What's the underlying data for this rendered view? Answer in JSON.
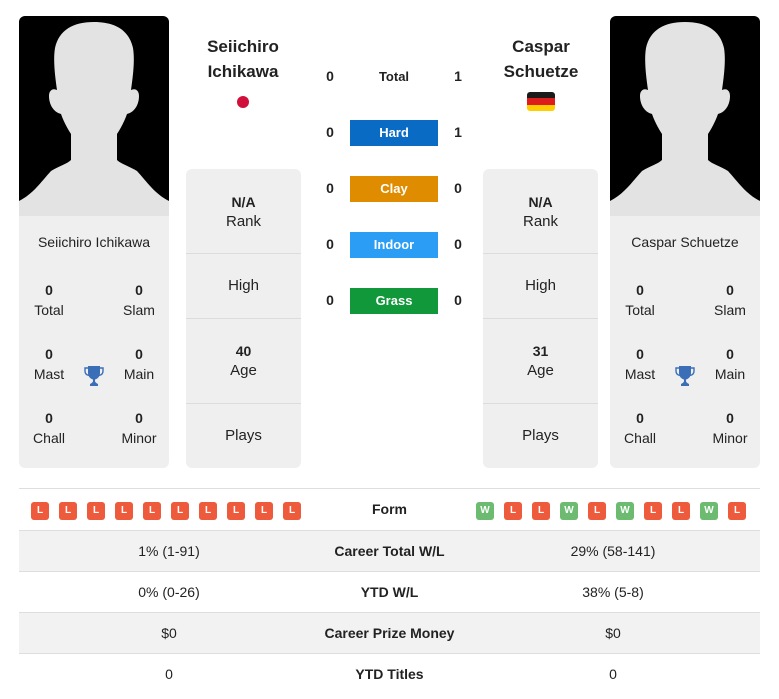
{
  "player1": {
    "name_line1": "Seiichiro",
    "name_line2": "Ichikawa",
    "full_name": "Seiichiro Ichikawa",
    "flag": "japan-flag",
    "titles": {
      "total": "0",
      "total_label": "Total",
      "slam": "0",
      "slam_label": "Slam",
      "mast": "0",
      "mast_label": "Mast",
      "main": "0",
      "main_label": "Main",
      "chall": "0",
      "chall_label": "Chall",
      "minor": "0",
      "minor_label": "Minor"
    },
    "rank": "N/A",
    "rank_label": "Rank",
    "high_label": "High",
    "age": "40",
    "age_label": "Age",
    "plays_label": "Plays",
    "form": [
      "L",
      "L",
      "L",
      "L",
      "L",
      "L",
      "L",
      "L",
      "L",
      "L"
    ]
  },
  "player2": {
    "name_line1": "Caspar",
    "name_line2": "Schuetze",
    "full_name": "Caspar Schuetze",
    "flag": "germany-flag",
    "titles": {
      "total": "0",
      "total_label": "Total",
      "slam": "0",
      "slam_label": "Slam",
      "mast": "0",
      "mast_label": "Mast",
      "main": "0",
      "main_label": "Main",
      "chall": "0",
      "chall_label": "Chall",
      "minor": "0",
      "minor_label": "Minor"
    },
    "rank": "N/A",
    "rank_label": "Rank",
    "high_label": "High",
    "age": "31",
    "age_label": "Age",
    "plays_label": "Plays",
    "form": [
      "W",
      "L",
      "L",
      "W",
      "L",
      "W",
      "L",
      "L",
      "W",
      "L"
    ]
  },
  "h2h": [
    {
      "label": "Total",
      "p1": "0",
      "p2": "1",
      "color": ""
    },
    {
      "label": "Hard",
      "p1": "0",
      "p2": "1",
      "color": "#0a6bc4"
    },
    {
      "label": "Clay",
      "p1": "0",
      "p2": "0",
      "color": "#e08c00"
    },
    {
      "label": "Indoor",
      "p1": "0",
      "p2": "0",
      "color": "#2b9df4"
    },
    {
      "label": "Grass",
      "p1": "0",
      "p2": "0",
      "color": "#11983a"
    }
  ],
  "stats": {
    "form_label": "Form",
    "rows": [
      {
        "label": "Career Total W/L",
        "p1": "1% (1-91)",
        "p2": "29% (58-141)"
      },
      {
        "label": "YTD W/L",
        "p1": "0% (0-26)",
        "p2": "38% (5-8)"
      },
      {
        "label": "Career Prize Money",
        "p1": "$0",
        "p2": "$0"
      },
      {
        "label": "YTD Titles",
        "p1": "0",
        "p2": "0"
      }
    ]
  },
  "colors": {
    "trophy": "#3a6fb7",
    "loss": "#ee5a3c",
    "win": "#6cbb70",
    "japan_red": "#d0103a"
  }
}
